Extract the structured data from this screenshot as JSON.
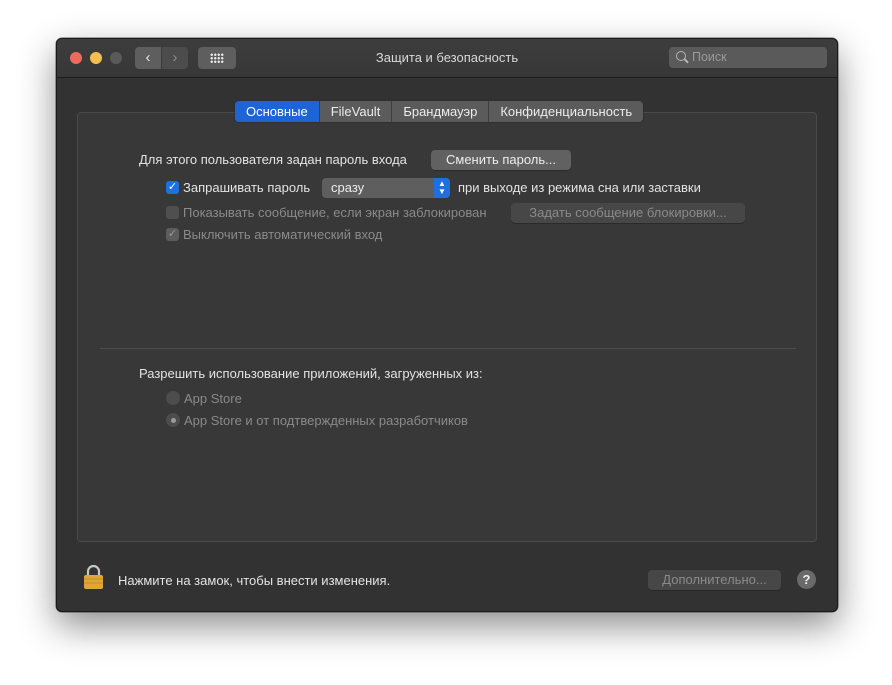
{
  "window": {
    "title": "Защита и безопасность",
    "search_placeholder": "Поиск"
  },
  "tabs": [
    {
      "label": "Основные",
      "active": true
    },
    {
      "label": "FileVault",
      "active": false
    },
    {
      "label": "Брандмауэр",
      "active": false
    },
    {
      "label": "Конфиденциальность",
      "active": false
    }
  ],
  "general": {
    "password_set_label": "Для этого пользователя задан пароль входа",
    "change_password_button": "Сменить пароль...",
    "require_password": {
      "label": "Запрашивать пароль",
      "checked": true
    },
    "require_select_value": "сразу",
    "require_suffix": "при выходе из режима сна или заставки",
    "show_message": {
      "label": "Показывать сообщение, если экран заблокирован",
      "checked": false,
      "disabled": true
    },
    "set_message_button": "Задать сообщение блокировки...",
    "disable_autologin": {
      "label": "Выключить автоматический вход",
      "checked": true,
      "disabled": true
    }
  },
  "apps": {
    "heading": "Разрешить использование приложений, загруженных из:",
    "options": [
      {
        "label": "App Store",
        "selected": false
      },
      {
        "label": "App Store и от подтвержденных разработчиков",
        "selected": true
      }
    ]
  },
  "footer": {
    "lock_text": "Нажмите на замок, чтобы внести изменения.",
    "advanced_button": "Дополнительно...",
    "help_label": "?"
  },
  "colors": {
    "accent": "#1e6fe0",
    "window_bg": "#323232",
    "lock_gold": "#e0a63a"
  }
}
